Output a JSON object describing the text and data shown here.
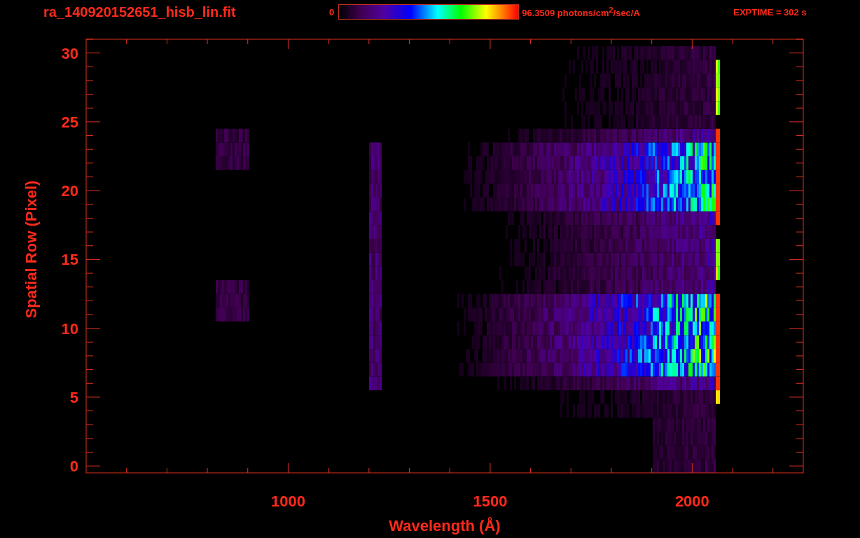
{
  "header": {
    "title": "ra_140920152651_hisb_lin.fit",
    "colorbar_min": "0",
    "colorbar_max": "96.3509 photons/cm$^{2}$/sec/A",
    "exposure": "EXPTIME = 302 s"
  },
  "plot": {
    "xlabel": "Wavelength (Å)",
    "ylabel": "Spatial Row (Pixel)",
    "x_tick_labels": [
      "1000",
      "1500",
      "2000"
    ],
    "y_tick_labels": [
      "30",
      "25",
      "20",
      "15",
      "10",
      "5",
      "0"
    ]
  }
}
